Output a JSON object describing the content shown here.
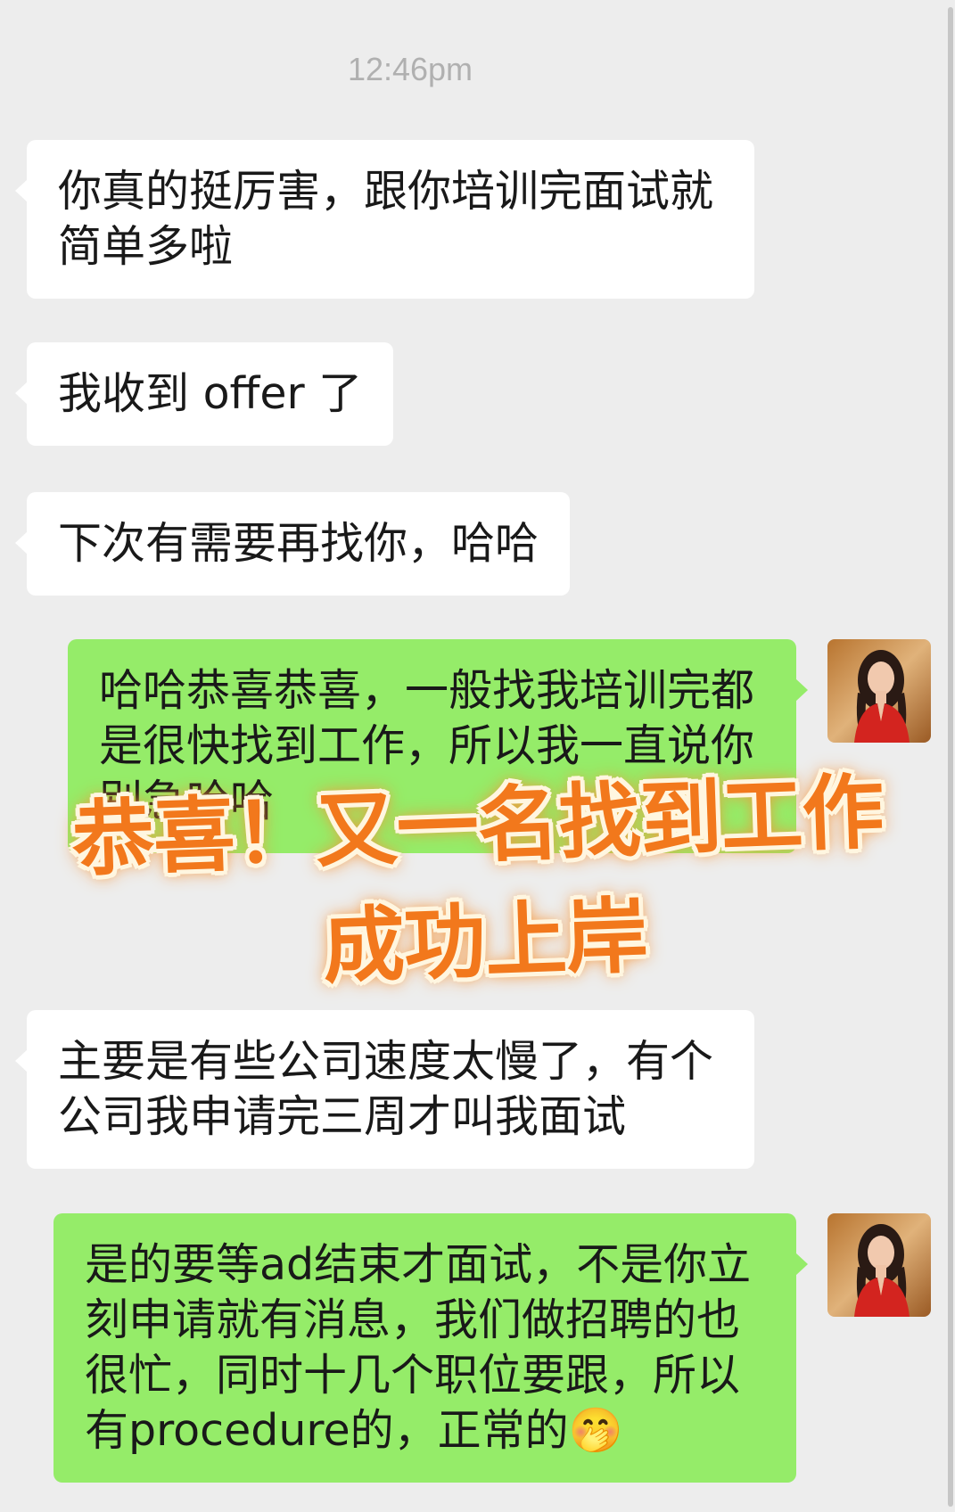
{
  "timestamp": "12:46pm",
  "messages": [
    {
      "text": "你真的挺厉害，跟你培训完面试就简单多啦"
    },
    {
      "text": "我收到 offer 了"
    },
    {
      "text": "下次有需要再找你，哈哈"
    },
    {
      "text": "哈哈恭喜恭喜，一般找我培训完都是很快找到工作，所以我一直说你别急哈哈"
    },
    {
      "text": "主要是有些公司速度太慢了，有个公司我申请完三周才叫我面试"
    },
    {
      "text": "是的要等ad结束才面试，不是你立刻申请就有消息，我们做招聘的也很忙，同时十几个职位要跟，所以有procedure的，正常的🤭"
    }
  ],
  "overlay": {
    "line1": "恭喜！又一名找到工作",
    "line2": "成功上岸"
  },
  "colors": {
    "background": "#ededed",
    "bubble_incoming": "#ffffff",
    "bubble_outgoing": "#95ec69",
    "overlay_text": "#f2781c"
  }
}
